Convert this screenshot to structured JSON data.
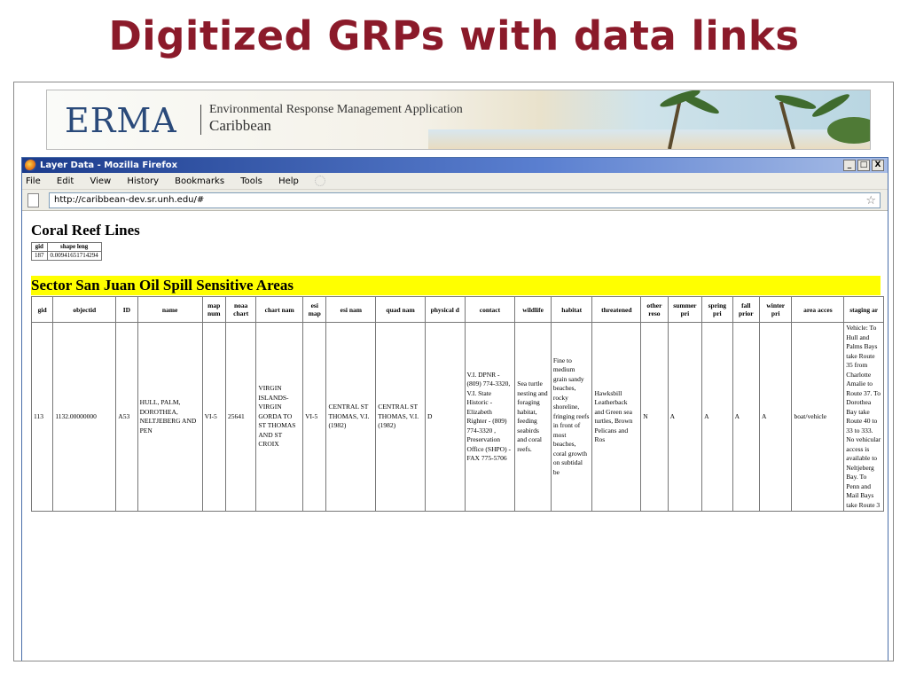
{
  "slide": {
    "title": "Digitized GRPs with data links"
  },
  "banner": {
    "logo": "ERMA",
    "line1": "Environmental Response Management Application",
    "line2": "Caribbean"
  },
  "window": {
    "title": "Layer Data - Mozilla Firefox",
    "buttons": {
      "minimize": "_",
      "maximize": "□",
      "close": "X"
    },
    "menu": [
      "File",
      "Edit",
      "View",
      "History",
      "Bookmarks",
      "Tools",
      "Help"
    ],
    "url": "http://caribbean-dev.sr.unh.edu/#"
  },
  "coral": {
    "title": "Coral Reef Lines",
    "headers": [
      "gid",
      "shape leng"
    ],
    "row": [
      "187",
      "0.00941651714294"
    ]
  },
  "sector": {
    "title": "Sector San Juan Oil Spill Sensitive Areas",
    "headers": [
      "gid",
      "objectid",
      "ID",
      "name",
      "map num",
      "noaa chart",
      "chart nam",
      "esi map",
      "esi nam",
      "quad nam",
      "physical d",
      "contact",
      "wildlife",
      "habitat",
      "threatened",
      "other reso",
      "summer pri",
      "spring pri",
      "fall prior",
      "winter pri",
      "area acces",
      "staging ar"
    ],
    "row": {
      "gid": "113",
      "objectid": "1132.00000000",
      "id": "A53",
      "name": "HULL, PALM, DOROTHEA, NELTJEBERG AND PEN",
      "map_num": "VI-5",
      "noaa_chart": "25641",
      "chart_nam": "VIRGIN ISLANDS- VIRGIN GORDA TO ST THOMAS AND ST CROIX",
      "esi_map": "VI-5",
      "esi_nam": "CENTRAL ST THOMAS, V.I. (1982)",
      "quad_nam": "CENTRAL ST THOMAS, V.I. (1982)",
      "physical": "D",
      "contact": "V.I. DPNR - (809) 774-3320, V.I. State Historic - Elizabeth Righter - (809) 774-3320 , Preservation Office (SHPO) - FAX 775-5706",
      "wildlife": "Sea turtle nesting and foraging habitat, feeding seabirds and coral reefs.",
      "habitat": "Fine to medium grain sandy beaches, rocky shoreline, fringing reefs in front of most beaches, coral growth on subtidal be",
      "threatened": "Hawksbill Leatherback and Green sea turtles, Brown Pelicans and Ros",
      "other": "N",
      "summer": "A",
      "spring": "A",
      "fall": "A",
      "winter": "A",
      "area": "boat/vehicle",
      "staging": "Vehicle: To Hull and Palms Bays take Route 35 from Charlotte Amalie to Route 37. To Dorothea Bay take Route 40 to 33 to 333. No vehicular access is available to Neltjeberg Bay. To Penn and Mail Bays take Route 3"
    }
  },
  "colors": {
    "title": "#8b1a2a",
    "highlight": "#ffff00",
    "titlebar": "#1c3c8c"
  }
}
